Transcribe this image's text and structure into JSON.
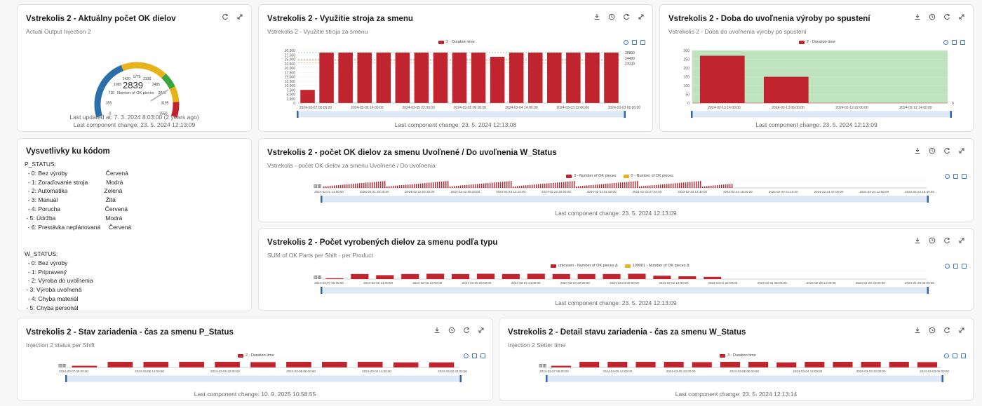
{
  "colors": {
    "bar": "#c0252f",
    "bar_yellow": "#e8b21a",
    "band_green": "#bfe3bf",
    "slider": "#dde9f7",
    "slider_handle": "#2f66b3"
  },
  "cards": {
    "gauge": {
      "title": "Vstrekolis 2 - Aktuálny počet OK dielov",
      "subtitle": "Actual Output Injection 2",
      "value": "2839",
      "value_label": "Number of OK pieces",
      "ticks": [
        "0",
        "355",
        "710",
        "1065",
        "1420",
        "1775",
        "2130",
        "2485",
        "2840",
        "3195",
        "3550"
      ],
      "gauge_fraction": 0.8,
      "updated": "Last updated at: 7. 3. 2024 8:03:00 (2 years ago)",
      "changed": "Last component change: 23. 5. 2024 12:13:09",
      "tools": [
        "refresh-icon",
        "expand-icon"
      ]
    },
    "utilization": {
      "title": "Vstrekolis 2 - Využitie stroja za smenu",
      "subtitle": "Vstrekolis 2 - Využitie stroja za smenu",
      "changed": "Last component change: 23. 5. 2024 12:13:08",
      "tools": [
        "download-icon",
        "history-icon",
        "refresh-icon",
        "expand-icon"
      ]
    },
    "release": {
      "title": "Vstrekolis 2 - Doba do uvoľnenia výroby po spustení",
      "subtitle": "Vstrekolis 2 - Doba do uvoľnenia výroby po spustení",
      "changed": "Last component change: 23. 5. 2024 12:13:09",
      "tools": [
        "download-icon",
        "history-icon",
        "refresh-icon",
        "expand-icon"
      ]
    },
    "codes": {
      "title": "Vysvetlivky ku kódom",
      "text": "P_STATUS:\n  - 0: Bez výroby                       Červená\n  - 1: Zoraďovanie stroja           Modrá\n  - 2: Automatika                      Zelená\n  - 3: Manuál                             Žltá\n  - 4: Porucha                           Červená\n - 5: Údržba                              Modrá\n  - 6: Prestávka neplánovaná     Červená\n\n\nW_STATUS:\n  - 0: Bez výroby\n  - 1: Pripravený\n  - 2: Výroba do uvoľnenia\n - 3: Výroba uvoľnená\n  - 4: Chyba materiál\n - 5: Chyba personál"
    },
    "ok_count": {
      "title": "Vstrekolis 2 - počet OK dielov za smenu Uvoľnené / Do uvoľnenia W_Status",
      "subtitle": "Vstrekolis - počet OK dielov za smenu Uvoľnené / Do uvoľnenia",
      "changed": "Last component change: 23. 5. 2024 12:13:09",
      "tools": [
        "download-icon",
        "history-icon",
        "refresh-icon",
        "expand-icon"
      ]
    },
    "per_type": {
      "title": "Vstrekolis 2 - Počet vyrobených dielov za smenu podľa typu",
      "subtitle": "SUM of OK Parts per Shift - per Product",
      "changed": "Last component change: 23. 5. 2024 12:13:09",
      "tools": [
        "download-icon",
        "history-icon",
        "refresh-icon",
        "expand-icon"
      ]
    },
    "p_status": {
      "title": "Vstrekolis 2 - Stav zariadenia - čas za smenu P_Status",
      "subtitle": "Injection 2 status per Shift",
      "changed": "Last component change: 10. 9. 2025 10:58:55",
      "tools": [
        "download-icon",
        "history-icon",
        "refresh-icon",
        "expand-icon"
      ]
    },
    "w_status": {
      "title": "Vstrekolis 2 - Detail stavu zariadenia - čas za smenu W_Status",
      "subtitle": "Injection 2 Setter time",
      "changed": "Last component change: 23. 5. 2024 12:13:14",
      "tools": [
        "download-icon",
        "history-icon",
        "refresh-icon",
        "expand-icon"
      ]
    }
  },
  "chart_data": [
    {
      "id": "utilization",
      "type": "bar",
      "legend": [
        "2 - Duration time"
      ],
      "y_ticks": [
        "30,000",
        "27,500",
        "25,000",
        "22,500",
        "20,000",
        "17,500",
        "15,000",
        "12,500",
        "10,000",
        "7,500",
        "5,000",
        "2,500",
        "0"
      ],
      "ylim": [
        0,
        30000
      ],
      "marklines": [
        "28800",
        "24480",
        "23040"
      ],
      "x_ticks": [
        "2024-03-07 06:00:00",
        "2024-03-06 14:00:00",
        "2024-03-05 22:00:00",
        "2024-03-05 06:00:00",
        "2024-03-04 14:00:00",
        "2024-03-03 22:00:00",
        "2024-03-03 06:00:00"
      ],
      "values": [
        7500,
        28800,
        28800,
        28800,
        28800,
        28800,
        28800,
        28800,
        28800,
        28800,
        26400,
        28800,
        28800,
        28800,
        28800,
        28800,
        28800
      ]
    },
    {
      "id": "release",
      "type": "bar",
      "legend": [
        "2 - Duration time"
      ],
      "y_ticks": [
        "300",
        "250",
        "200",
        "150",
        "100",
        "50",
        "0"
      ],
      "ylim": [
        0,
        300
      ],
      "marklines": [
        "0"
      ],
      "x_ticks": [
        "2024-02-13 14:00:00",
        "2024-02-13 06:00:00",
        "2024-02-12 22:00:00",
        "2024-02-12 14:00:00"
      ],
      "values": [
        270,
        150,
        0,
        0
      ]
    },
    {
      "id": "ok_count",
      "type": "bar",
      "legend": [
        "3 - Number of OK pieces",
        "0 - Number of OK pieces"
      ],
      "x_ticks": [
        "2024-02-21 14:50:00",
        "2024-02-21 20:40:00",
        "2024-02-22 02:30:00",
        "2024-02-22 08:20:00",
        "2024-02-22 14:10:00",
        "2024-02-22 20:00:00",
        "2024-02-23 01:50:00",
        "2024-02-23 07:40:00",
        "2024-02-23 13:30:00",
        "2024-02-23 19:20:00",
        "2024-02-24 01:10:00",
        "2024-02-24 07:00:00",
        "2024-02-24 12:50:00",
        "2024-02-24 18:40:00"
      ]
    },
    {
      "id": "per_type",
      "type": "bar",
      "legend": [
        "unknown - Number of OK pieces Δ",
        "100001 - Number of OK pieces Δ"
      ],
      "x_ticks": [
        "2024-03-07 06:00:00",
        "2024-03-06 14:00:00",
        "2024-03-05 22:00:00",
        "2024-03-05 06:00:00",
        "2024-03-04 14:00:00",
        "2024-03-03 22:00:00",
        "2024-03-03 06:00:00",
        "2024-03-02 14:00:00",
        "2024-03-01 22:00:00",
        "2024-03-01 06:00:00",
        "2024-02-29 14:00:00",
        "2024-02-28 22:00:00",
        "2024-02-28 06:00:00"
      ],
      "values": [
        0.15,
        0.9,
        0.7,
        0.9,
        0.95,
        0.9,
        0.95,
        0.9,
        0.95,
        0.9,
        0.9,
        0.9,
        0.95,
        0.6,
        0.5,
        0.4,
        0,
        0,
        0,
        0,
        0,
        0,
        0,
        0
      ]
    },
    {
      "id": "p_status",
      "type": "bar",
      "legend": [
        "2 - Duration time"
      ],
      "x_ticks": [
        "2024-03-07 06:00:00",
        "2024-03-06 14:00:00",
        "2024-03-05 22:00:00",
        "2024-03-05 06:00:00",
        "2024-03-04 14:00:00",
        "2024-03-03 22:00:00"
      ],
      "values": [
        0.3,
        1,
        1,
        1,
        1,
        0.95,
        1,
        1,
        1,
        0.9,
        0.9
      ]
    },
    {
      "id": "w_status",
      "type": "bar",
      "legend": [
        "3 - Duration time"
      ],
      "x_ticks": [
        "2024-03-07 06:00:00",
        "2024-03-06 14:00:00",
        "2024-03-05 22:00:00",
        "2024-03-05 06:00:00",
        "2024-03-04 14:00:00",
        "2024-03-03 22:00:00",
        "2024-03-03 06:00:00"
      ],
      "values": [
        0.3,
        1,
        1,
        1,
        1,
        0.95,
        1,
        1,
        0.9,
        1,
        1,
        1,
        1,
        0.95
      ]
    }
  ]
}
